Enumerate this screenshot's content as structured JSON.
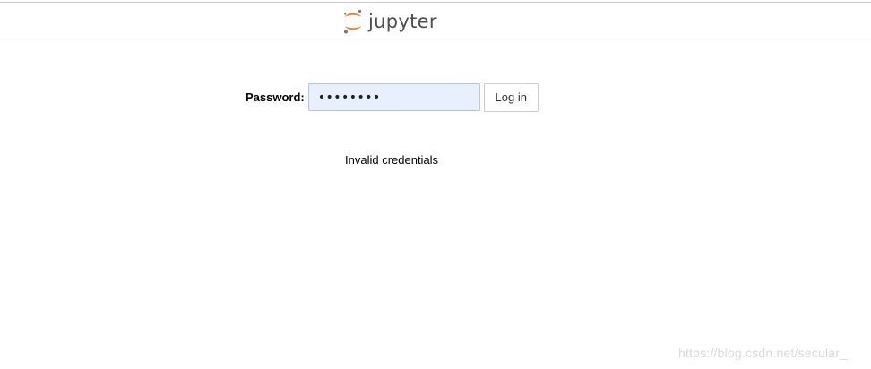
{
  "header": {
    "logo_text": "jupyter",
    "logo_icon": "jupyter-logo-icon",
    "colors": {
      "orange": "#f37726",
      "gray": "#767677"
    }
  },
  "login": {
    "password_label": "Password:",
    "password_value": "••••••••",
    "login_button_label": "Log in"
  },
  "message": {
    "text": "Invalid credentials"
  },
  "watermark": {
    "text": "https://blog.csdn.net/secular_"
  }
}
